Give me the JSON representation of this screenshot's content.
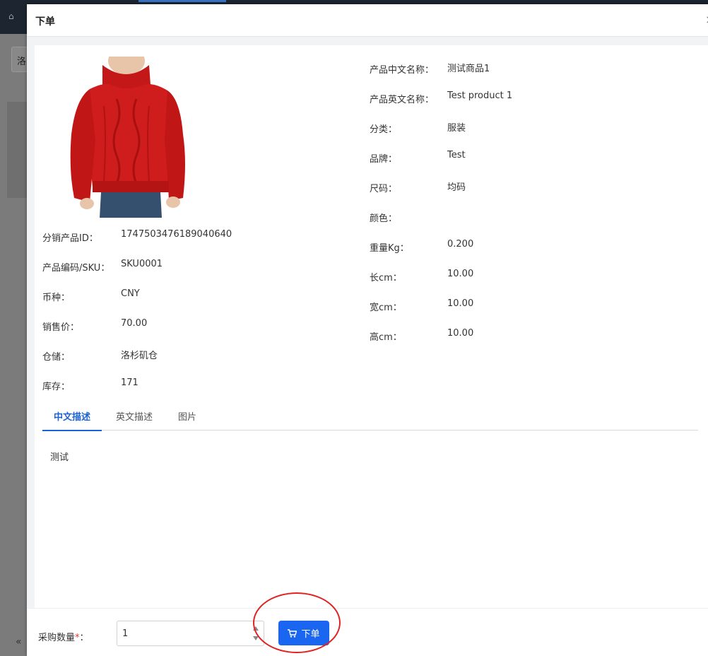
{
  "background": {
    "select_value": "洛"
  },
  "modal": {
    "title": "下单",
    "close_symbol": "×"
  },
  "product": {
    "image_alt": "red turtleneck sweater",
    "left_details": [
      {
        "label": "分销产品ID：",
        "value": "1747503476189040640"
      },
      {
        "label": "产品编码/SKU：",
        "value": "SKU0001"
      },
      {
        "label": "币种：",
        "value": "CNY"
      },
      {
        "label": "销售价：",
        "value": "70.00"
      },
      {
        "label": "仓储：",
        "value": "洛杉矶仓"
      },
      {
        "label": "库存：",
        "value": "171"
      }
    ],
    "right_details": [
      {
        "label": "产品中文名称：",
        "value": "测试商品1"
      },
      {
        "label": "产品英文名称：",
        "value": "Test product 1"
      },
      {
        "label": "分类：",
        "value": "服装"
      },
      {
        "label": "品牌：",
        "value": "Test"
      },
      {
        "label": "尺码：",
        "value": "均码"
      },
      {
        "label": "颜色：",
        "value": ""
      },
      {
        "label": "重量Kg：",
        "value": "0.200"
      },
      {
        "label": "长cm：",
        "value": "10.00"
      },
      {
        "label": "宽cm：",
        "value": "10.00"
      },
      {
        "label": "高cm：",
        "value": "10.00"
      }
    ]
  },
  "tabs": [
    {
      "label": "中文描述",
      "active": true
    },
    {
      "label": "英文描述",
      "active": false
    },
    {
      "label": "图片",
      "active": false
    }
  ],
  "description": "测试",
  "footer": {
    "quantity_label": "采购数量",
    "required_mark": "*",
    "colon": "：",
    "quantity_value": "1",
    "order_button_label": "下单"
  },
  "colors": {
    "primary": "#1a66f0",
    "tab_active": "#1a62d6",
    "annotation": "#e12222",
    "required": "#ee3333"
  },
  "icons": {
    "home": "home-icon",
    "close": "close-icon",
    "cart": "cart-icon",
    "spin_up": "caret-up-icon",
    "spin_down": "caret-down-icon",
    "collapse": "double-chevron-left-icon"
  }
}
